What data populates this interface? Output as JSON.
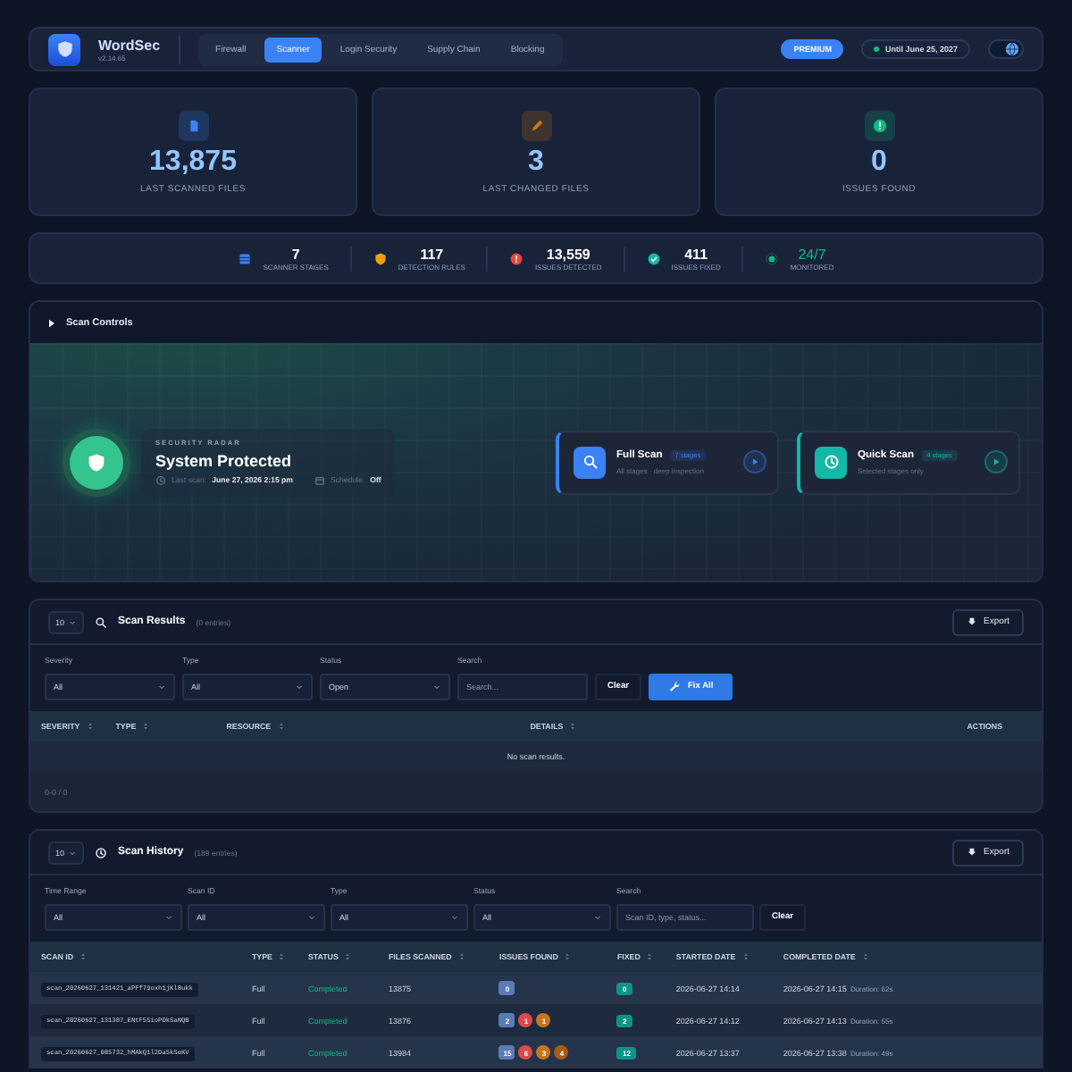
{
  "app": {
    "name": "WordSec",
    "version": "v2.14.65"
  },
  "nav": [
    {
      "label": "Firewall",
      "selected": false
    },
    {
      "label": "Scanner",
      "selected": true
    },
    {
      "label": "Login Security",
      "selected": false
    },
    {
      "label": "Supply Chain",
      "selected": false
    },
    {
      "label": "Blocking",
      "selected": false
    }
  ],
  "theme_toggle": {
    "on": true
  },
  "premium_badge": "PREMIUM",
  "license": "Until June 25, 2027",
  "stat_cards": [
    {
      "kind": "file",
      "value": "13,875",
      "label": "LAST SCANNED FILES",
      "color": "#3b82f6"
    },
    {
      "kind": "pencil",
      "value": "3",
      "label": "LAST CHANGED FILES",
      "color": "#d97706"
    },
    {
      "kind": "alert",
      "value": "0",
      "label": "ISSUES FOUND",
      "color": "#10b981"
    }
  ],
  "summary": [
    {
      "kind": "layers",
      "value": "7",
      "label": "SCANNER STAGES",
      "color": "#3b82f6"
    },
    {
      "kind": "shield",
      "value": "117",
      "label": "DETECTION RULES",
      "color": "#f59e0b"
    },
    {
      "kind": "alert",
      "value": "13,559",
      "label": "ISSUES DETECTED",
      "color": "#ef4444"
    },
    {
      "kind": "check",
      "value": "411",
      "label": "ISSUES FIXED",
      "color": "#14b8a6"
    },
    {
      "kind": "dot",
      "value": "24/7",
      "label": "MONITORED",
      "color": "#10b981"
    }
  ],
  "scan_controls": {
    "title": "Scan Controls",
    "eyebrow": "SECURITY RADAR",
    "status": "System Protected",
    "last_scan_label": "Last scan:",
    "last_scan": "June 27, 2026 2:15 pm",
    "schedule_label": "Schedule:",
    "schedule": "Off",
    "buttons": [
      {
        "kind": "search",
        "title": "Full Scan",
        "badge": "7 stages",
        "subtitle": "All stages · deep inspection",
        "color": "#3b82f6"
      },
      {
        "kind": "clock",
        "title": "Quick Scan",
        "badge": "4 stages",
        "subtitle": "Selected stages only",
        "color": "#14b8a6"
      }
    ]
  },
  "results": {
    "page_size": "10",
    "title": "Scan Results",
    "count": "(0 entries)",
    "export": "Export",
    "filters": [
      {
        "label": "Severity",
        "value": "All"
      },
      {
        "label": "Type",
        "value": "All"
      },
      {
        "label": "Status",
        "value": "Open"
      }
    ],
    "search": {
      "label": "Search",
      "placeholder": "Search..."
    },
    "clear": "Clear",
    "fix_all": "Fix All",
    "columns": [
      "SEVERITY",
      "TYPE",
      "RESOURCE",
      "DETAILS",
      "ACTIONS"
    ],
    "empty": "No scan results.",
    "footer": "0-0 / 0"
  },
  "history": {
    "page_size": "10",
    "title": "Scan History",
    "count": "(189 entries)",
    "export": "Export",
    "filters": [
      {
        "label": "Time Range",
        "value": "All"
      },
      {
        "label": "Scan ID",
        "value": "All"
      },
      {
        "label": "Type",
        "value": "All"
      },
      {
        "label": "Status",
        "value": "All"
      }
    ],
    "search": {
      "label": "Search",
      "placeholder": "Scan ID, type, status..."
    },
    "clear": "Clear",
    "columns": [
      "SCAN ID",
      "TYPE",
      "STATUS",
      "FILES SCANNED",
      "ISSUES FOUND",
      "FIXED",
      "STARTED DATE",
      "COMPLETED DATE"
    ],
    "rows": [
      {
        "scan_id": "scan_20260627_131421_aPFf79oxh1jKl8ukk",
        "type": "Full",
        "status": "Completed",
        "files": "13875",
        "issues": [
          {
            "count": "0",
            "color": "#5b7bb5"
          }
        ],
        "fixed": "0",
        "started": "2026-06-27 14:14",
        "completed": "2026-06-27 14:15",
        "duration": "Duration: 62s"
      },
      {
        "scan_id": "scan_20260627_131387_ENtF55ioPDkSaNQB",
        "type": "Full",
        "status": "Completed",
        "files": "13876",
        "issues": [
          {
            "count": "2",
            "color": "#5b7bb5"
          },
          {
            "count": "1",
            "color": "#dc4a4a"
          },
          {
            "count": "1",
            "color": "#c8741f"
          }
        ],
        "fixed": "2",
        "started": "2026-06-27 14:12",
        "completed": "2026-06-27 14:13",
        "duration": "Duration: 55s"
      },
      {
        "scan_id": "scan_20260627_085732_hMAkQ1l2Da5kSeKV",
        "type": "Full",
        "status": "Completed",
        "files": "13984",
        "issues": [
          {
            "count": "15",
            "color": "#5b7bb5"
          },
          {
            "count": "6",
            "color": "#dc4a4a"
          },
          {
            "count": "3",
            "color": "#c8741f"
          },
          {
            "count": "4",
            "color": "#a85a18"
          }
        ],
        "fixed": "12",
        "started": "2026-06-27 13:37",
        "completed": "2026-06-27 13:38",
        "duration": "Duration: 49s"
      }
    ]
  }
}
